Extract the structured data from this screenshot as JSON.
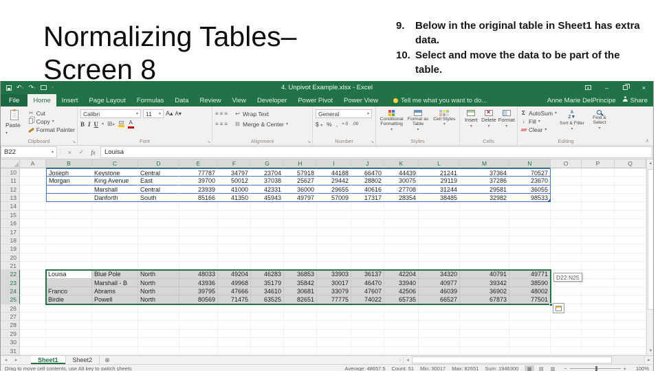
{
  "slide": {
    "title": "Normalizing Tables–Screen 8",
    "steps": [
      {
        "num": "9.",
        "text": "Below in the original table in Sheet1 has extra data."
      },
      {
        "num": "10.",
        "text": "Select and move the data to be part of the table."
      }
    ]
  },
  "colors": {
    "excel_green": "#217346",
    "table_border": "#4472c4",
    "selection_fill": "#d6d6d6"
  },
  "excel": {
    "title": "4. Unpivot Example.xlsx - Excel",
    "user": "Anne Marie DelPrincipe",
    "share_label": "Share",
    "tell_me": "Tell me what you want to do...",
    "tabs": [
      "File",
      "Home",
      "Insert",
      "Page Layout",
      "Formulas",
      "Data",
      "Review",
      "View",
      "Developer",
      "Power Pivot",
      "Power View"
    ],
    "active_tab": "Home",
    "ribbon": {
      "clipboard": {
        "label": "Clipboard",
        "paste": "Paste",
        "cut": "Cut",
        "copy": "Copy",
        "format_painter": "Format Painter"
      },
      "font": {
        "label": "Font",
        "family": "Calibri",
        "size": "11",
        "bold": "B",
        "italic": "I",
        "underline": "U"
      },
      "alignment": {
        "label": "Alignment",
        "wrap": "Wrap Text",
        "merge": "Merge & Center"
      },
      "number": {
        "label": "Number",
        "format": "General",
        "symbols": [
          "$",
          "%",
          ","
        ],
        "decimals": [
          "+.0",
          ".00"
        ]
      },
      "styles": {
        "label": "Styles",
        "conditional": "Conditional Formatting",
        "format_table": "Format as Table",
        "cell_styles": "Cell Styles"
      },
      "cells": {
        "label": "Cells",
        "insert": "Insert",
        "delete": "Delete",
        "format": "Format"
      },
      "editing": {
        "label": "Editing",
        "autosum": "AutoSum",
        "fill": "Fill",
        "clear": "Clear",
        "sort": "Sort & Filter",
        "find": "Find & Select"
      }
    },
    "formula_bar": {
      "name_box": "B22",
      "fx": "fx",
      "content": "Louisa"
    },
    "grid": {
      "columns": [
        "A",
        "B",
        "C",
        "D",
        "E",
        "F",
        "G",
        "H",
        "I",
        "J",
        "K",
        "L",
        "M",
        "N",
        "O",
        "P",
        "Q"
      ],
      "first_row": 10,
      "last_row": 31,
      "table": {
        "first_row": 10,
        "first_col": "B",
        "rows": [
          [
            "Joseph",
            "Keystone",
            "Central",
            "77787",
            "34797",
            "23704",
            "57918",
            "44188",
            "66470",
            "44439",
            "21241",
            "37364",
            "70527"
          ],
          [
            "Morgan",
            "King Avenue",
            "East",
            "39700",
            "50012",
            "37038",
            "25627",
            "29442",
            "28802",
            "30075",
            "29119",
            "37286",
            "23670"
          ],
          [
            "",
            "Marshall",
            "Central",
            "23939",
            "41000",
            "42331",
            "36000",
            "29655",
            "40616",
            "27708",
            "31244",
            "29581",
            "36055"
          ],
          [
            "",
            "Danforth",
            "South",
            "85166",
            "41350",
            "45943",
            "49797",
            "57009",
            "17317",
            "28354",
            "38485",
            "32982",
            "98533"
          ]
        ]
      },
      "selection": {
        "first_row": 22,
        "first_col": "B",
        "active_cell": "B22",
        "range_tooltip": "D22:N25",
        "rows": [
          [
            "Louisa",
            "Blue Pole",
            "North",
            "48033",
            "49204",
            "46283",
            "36853",
            "33903",
            "36137",
            "42204",
            "34320",
            "40791",
            "49771"
          ],
          [
            "",
            "Marshall - B",
            "North",
            "43936",
            "49968",
            "35179",
            "35842",
            "30017",
            "46470",
            "33940",
            "40977",
            "39342",
            "38590"
          ],
          [
            "Franco",
            "Abrams",
            "North",
            "39795",
            "47666",
            "34610",
            "30681",
            "33079",
            "47607",
            "42506",
            "46039",
            "36902",
            "48002"
          ],
          [
            "Birdie",
            "Powell",
            "North",
            "80569",
            "71475",
            "63525",
            "82651",
            "77775",
            "74022",
            "65735",
            "66527",
            "67873",
            "77501"
          ]
        ]
      }
    },
    "sheet_tabs": [
      "Sheet1",
      "Sheet2"
    ],
    "status_bar": {
      "hint": "Drag to move cell contents, use Alt key to switch sheets",
      "average": "Average: 48657.5",
      "count": "Count: 51",
      "min": "Min: 30017",
      "max": "Max: 82651",
      "sum": "Sum: 1946300",
      "zoom": "100%"
    }
  }
}
